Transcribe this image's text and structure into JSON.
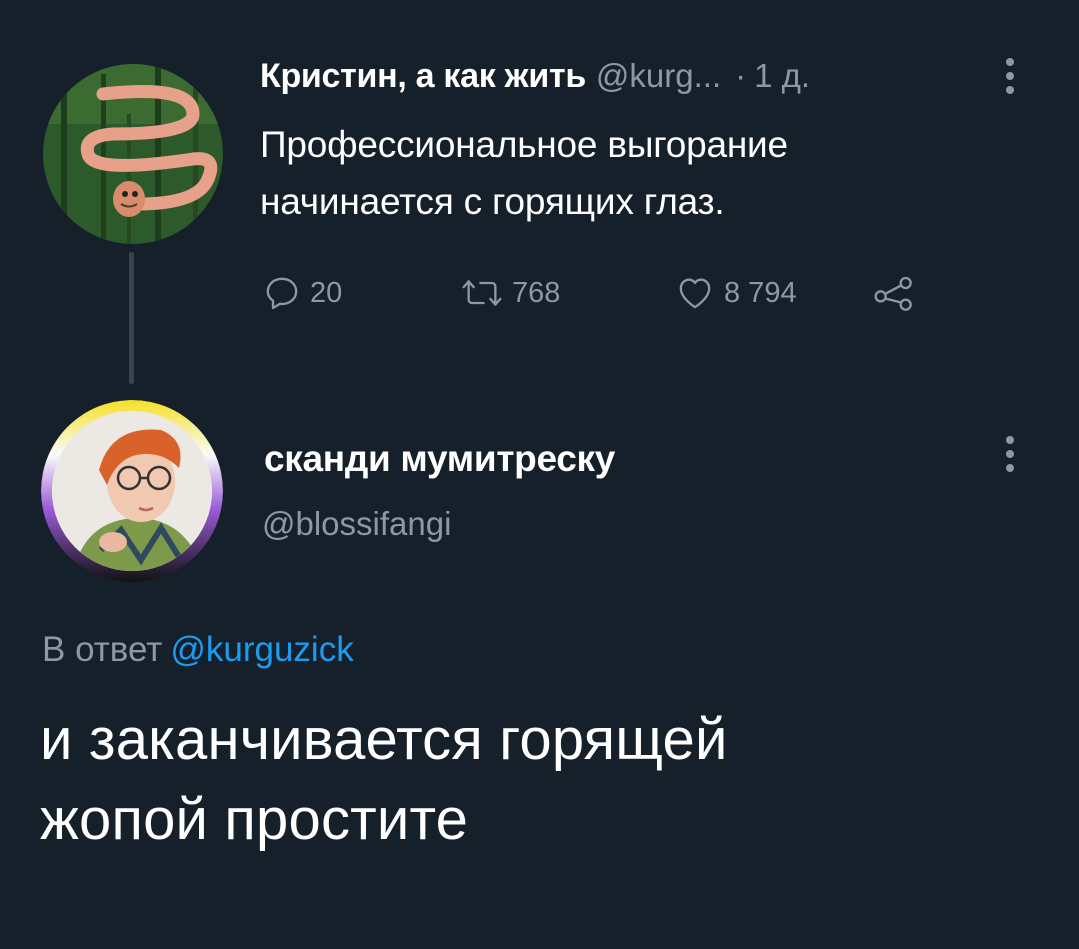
{
  "tweet1": {
    "author_name": "Кристин, а как жить",
    "author_handle": "@kurg...",
    "separator": "·",
    "time": "1 д.",
    "text_lines": [
      "Профессиональное выгорание",
      "начинается с горящих глаз."
    ],
    "reply_count": "20",
    "retweet_count": "768",
    "like_count": "8 794",
    "icons": {
      "more": "more-vertical-icon",
      "reply": "reply-icon",
      "retweet": "retweet-icon",
      "like": "heart-icon",
      "share": "share-icon"
    }
  },
  "tweet2": {
    "author_name": "сканди мумитреску",
    "author_handle": "@blossifangi",
    "reply_prefix": "В ответ",
    "reply_target": "@kurguzick",
    "text_lines": [
      "и заканчивается горящей",
      "жопой простите"
    ]
  },
  "colors": {
    "background": "#15202b",
    "primary_text": "#ffffff",
    "secondary_text": "#8b98a5",
    "link": "#1d9bf0",
    "thread_line": "#38444d"
  }
}
